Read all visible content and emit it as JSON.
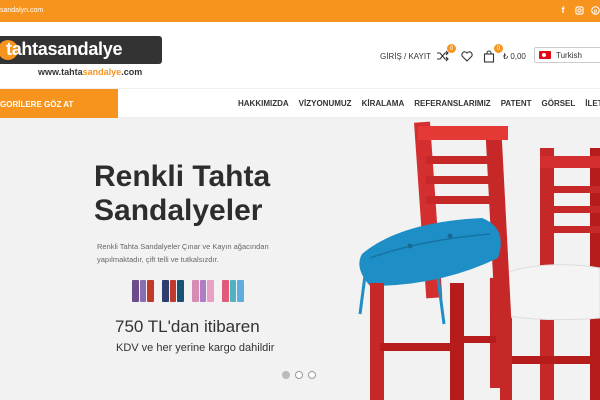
{
  "topbar": {
    "email": "sandalyn.com"
  },
  "header": {
    "logo_text": "tahtasandalye",
    "logo_url_prefix": "www.tahta",
    "logo_url_highlight": "sandalye",
    "logo_url_suffix": ".com",
    "login_label": "GİRİŞ / KAYIT",
    "compare_count": "0",
    "cart_count": "0",
    "cart_price": "₺ 0,00",
    "language": "Turkish"
  },
  "nav": {
    "categories_label": "GORİLERE GÖZ AT",
    "items": [
      "HAKKIMIZDA",
      "VİZYONUMUZ",
      "KİRALAMA",
      "REFERANSLARIMIZ",
      "PATENT",
      "GÖRSEL",
      "İLETİŞİM B"
    ]
  },
  "hero": {
    "title_line1": "Renkli Tahta",
    "title_line2": "Sandalyeler",
    "description": "Renkli Tahta Sandalyeler Çınar ve Kayın ağacından yapılmaktadır, çift telli ve tutkalsızdır.",
    "price": "750 TL'dan itibaren",
    "note": "KDV ve her yerine kargo dahildir",
    "slide_count": 3,
    "active_slide": 1
  },
  "colors": {
    "accent": "#f7941d",
    "chair_red": "#c62828",
    "cushion_blue": "#1e8fc6"
  }
}
